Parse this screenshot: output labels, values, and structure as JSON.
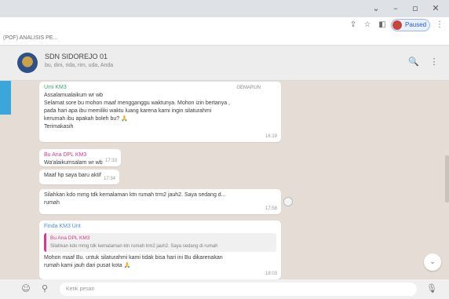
{
  "browser": {
    "window_controls": {
      "chevron": "⌄",
      "minimize": "–",
      "maximize": "▫",
      "close": "✕"
    },
    "toolbar_icons": {
      "share": "⇪",
      "star": "☆",
      "sidebar": "◧",
      "menu": "⋮"
    },
    "profile_label": "Paused",
    "bookmark_label": "(POF) ANALISIS PE..."
  },
  "chat": {
    "name": "SDN SIDOREJO 01",
    "members": "bu, dini, rida, rim, uda, Anda",
    "search_icon": "🔍",
    "menu_icon": "⋮"
  },
  "messages": [
    {
      "sender": "Umi KM3",
      "sender_color": "#3aa66b",
      "phone": "GEMARUN",
      "lines": [
        "Assalamualaikum wr wb",
        "Selamat sore bu mohon maaf mengganggu waktunya. Mohon izin bertanya ,",
        "pada hari apa ibu memiliki waktu luang karena kami ingin silaturahmi",
        "kerumah ibu apakah boleh bu?",
        "Terimakasih"
      ],
      "time": "16:19"
    },
    {
      "sender": "Bu Ana DPL KM3",
      "sender_color": "#d63a8f",
      "lines": [
        "Wa'alaikumsalam wr wb"
      ],
      "time": "17:33"
    },
    {
      "lines": [
        "Maaf hp saya baru aktif"
      ],
      "time": "17:34"
    },
    {
      "lines": [
        "Silahkan kdo mmg tdk kemalaman ktn rumah trm2 jauh2. Saya sedang d...",
        "rumah"
      ],
      "time": "17:58"
    },
    {
      "sender": "Finda KM3 Unt",
      "sender_color": "#4a8fd8",
      "quote": {
        "name": "Bu Ana DPL KM3",
        "text": "Silahkan kdo mmg tdk kemalaman ktn rumah trm2 jauh2. Saya sedang di rumah"
      },
      "lines": [
        "Mohon maaf Bu. untuk silaturahmi kami tidak bisa hari ini Bu dikarenakan",
        "rumah kami jauh dari pusat kota"
      ],
      "time": "18:03"
    }
  ],
  "composer": {
    "placeholder": "Ketik pesan",
    "emoji_icon": "☺",
    "attach_icon": "⚲",
    "mic_icon": "🎙"
  },
  "scroll_down_icon": "⌄"
}
